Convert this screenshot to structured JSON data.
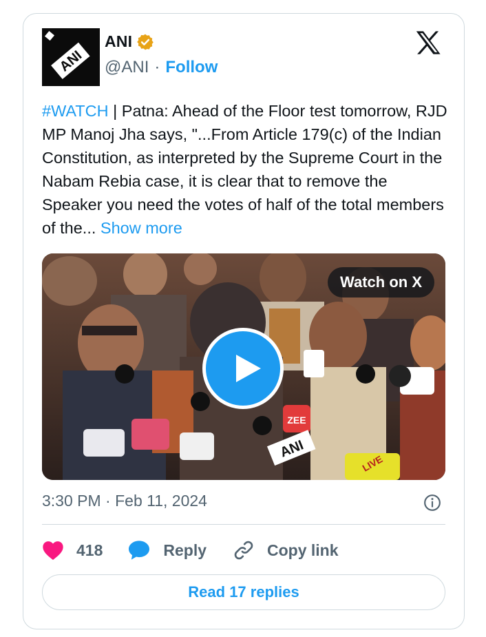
{
  "author": {
    "display_name": "ANI",
    "handle": "@ANI",
    "separator": "·",
    "follow_label": "Follow",
    "avatar_text": "ANI",
    "verified_color": "#E8A317"
  },
  "tweet": {
    "hashtag": "#WATCH",
    "body": " | Patna: Ahead of the Floor test tomorrow, RJD MP Manoj Jha says, \"...From Article 179(c) of the Indian Constitution, as interpreted by the Supreme Court in the Nabam Rebia case, it is clear that to remove the Speaker you need the votes of half of the total members of the...",
    "show_more": " Show more"
  },
  "media": {
    "watch_label": "Watch on X",
    "mic_labels": [
      "ANI",
      "ZEE",
      "LIVE"
    ]
  },
  "meta": {
    "time": "3:30 PM",
    "separator": "·",
    "date": "Feb 11, 2024"
  },
  "actions": {
    "like_count": "418",
    "reply_label": "Reply",
    "copy_link_label": "Copy link"
  },
  "footer": {
    "read_replies_label": "Read 17 replies"
  },
  "colors": {
    "accent": "#1d9bf0",
    "like": "#f91880",
    "text": "#0f1419",
    "muted": "#536471",
    "border": "#cfd9de"
  }
}
